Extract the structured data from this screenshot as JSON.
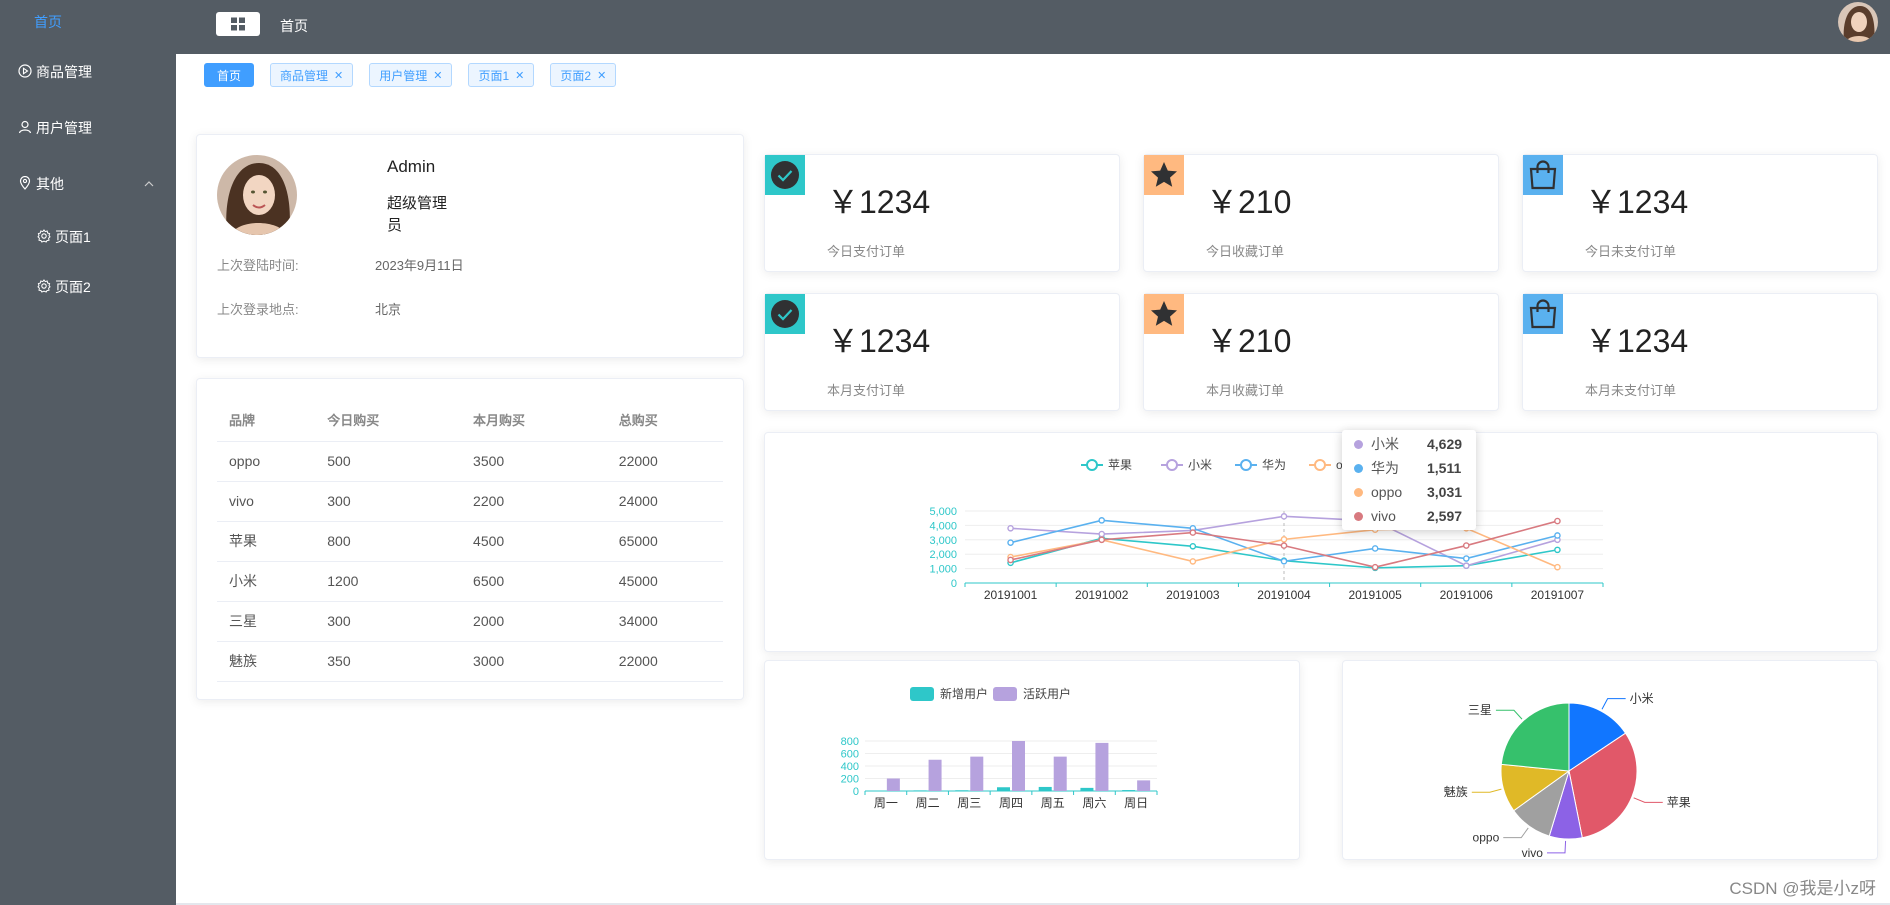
{
  "sidebar": {
    "top_label": "首页",
    "items": [
      {
        "label": "商品管理",
        "icon": "play-circle-icon"
      },
      {
        "label": "用户管理",
        "icon": "user-icon"
      },
      {
        "label": "其他",
        "icon": "location-icon"
      }
    ],
    "subitems": [
      {
        "label": "页面1",
        "icon": "gear-icon"
      },
      {
        "label": "页面2",
        "icon": "gear-icon"
      }
    ]
  },
  "header": {
    "breadcrumb": "首页"
  },
  "tabs": [
    {
      "label": "首页",
      "active": true
    },
    {
      "label": "商品管理"
    },
    {
      "label": "用户管理"
    },
    {
      "label": "页面1"
    },
    {
      "label": "页面2"
    }
  ],
  "user": {
    "name": "Admin",
    "role": "超级管理员",
    "last_login_time_label": "上次登陆时间:",
    "last_login_time": "2023年9月11日",
    "last_login_place_label": "上次登录地点:",
    "last_login_place": "北京"
  },
  "table": {
    "headers": [
      "品牌",
      "今日购买",
      "本月购买",
      "总购买"
    ],
    "rows": [
      [
        "oppo",
        "500",
        "3500",
        "22000"
      ],
      [
        "vivo",
        "300",
        "2200",
        "24000"
      ],
      [
        "苹果",
        "800",
        "4500",
        "65000"
      ],
      [
        "小米",
        "1200",
        "6500",
        "45000"
      ],
      [
        "三星",
        "300",
        "2000",
        "34000"
      ],
      [
        "魅族",
        "350",
        "3000",
        "22000"
      ]
    ]
  },
  "stats": [
    {
      "value": "￥1234",
      "label": "今日支付订单",
      "icon": "check-circle-icon",
      "color": "#2ec7c9"
    },
    {
      "value": "￥210",
      "label": "今日收藏订单",
      "icon": "star-icon",
      "color": "#ffb980"
    },
    {
      "value": "￥1234",
      "label": "今日未支付订单",
      "icon": "shopping-bag-icon",
      "color": "#5ab1ef"
    },
    {
      "value": "￥1234",
      "label": "本月支付订单",
      "icon": "check-circle-icon",
      "color": "#2ec7c9"
    },
    {
      "value": "￥210",
      "label": "本月收藏订单",
      "icon": "star-icon",
      "color": "#ffb980"
    },
    {
      "value": "￥1234",
      "label": "本月未支付订单",
      "icon": "shopping-bag-icon",
      "color": "#5ab1ef"
    }
  ],
  "tooltip": [
    {
      "name": "小米",
      "value": "4,629",
      "color": "#b6a2de"
    },
    {
      "name": "华为",
      "value": "1,511",
      "color": "#5ab1ef"
    },
    {
      "name": "oppo",
      "value": "3,031",
      "color": "#ffb980"
    },
    {
      "name": "vivo",
      "value": "2,597",
      "color": "#d87a80"
    }
  ],
  "watermark": "CSDN @我是小z呀",
  "chart_data": [
    {
      "type": "line",
      "x": [
        "20191001",
        "20191002",
        "20191003",
        "20191004",
        "20191005",
        "20191006",
        "20191007"
      ],
      "ylim": [
        0,
        5000
      ],
      "yticks": [
        "0",
        "1,000",
        "2,000",
        "3,000",
        "4,000",
        "5,000"
      ],
      "series": [
        {
          "name": "苹果",
          "color": "#2ec7c9",
          "values": [
            1400,
            3100,
            2550,
            1550,
            1050,
            1200,
            2300
          ]
        },
        {
          "name": "小米",
          "color": "#b6a2de",
          "values": [
            3800,
            3400,
            3650,
            4629,
            4300,
            1200,
            3000
          ]
        },
        {
          "name": "华为",
          "color": "#5ab1ef",
          "values": [
            2800,
            4350,
            3800,
            1511,
            2400,
            1700,
            3300
          ]
        },
        {
          "name": "oppo",
          "color": "#ffb980",
          "values": [
            1800,
            3000,
            1500,
            3031,
            3700,
            3800,
            1100
          ]
        },
        {
          "name": "vivo",
          "color": "#d87a80",
          "values": [
            1600,
            3000,
            3500,
            2597,
            1100,
            2600,
            4300
          ]
        }
      ]
    },
    {
      "type": "bar",
      "categories": [
        "周一",
        "周二",
        "周三",
        "周四",
        "周五",
        "周六",
        "周日"
      ],
      "ylim": [
        0,
        800
      ],
      "yticks": [
        "0",
        "200",
        "400",
        "600",
        "800"
      ],
      "series": [
        {
          "name": "新增用户",
          "color": "#2ec7c9",
          "values": [
            5,
            10,
            12,
            60,
            65,
            50,
            15
          ]
        },
        {
          "name": "活跃用户",
          "color": "#b6a2de",
          "values": [
            200,
            500,
            550,
            800,
            550,
            770,
            170
          ]
        }
      ]
    },
    {
      "type": "pie",
      "slices": [
        {
          "name": "小米",
          "value": 2999,
          "color": "#1176ff"
        },
        {
          "name": "苹果",
          "value": 5999,
          "color": "#e15869"
        },
        {
          "name": "vivo",
          "value": 1500,
          "color": "#8c62e6"
        },
        {
          "name": "oppo",
          "value": 1999,
          "color": "#a0a0a0"
        },
        {
          "name": "魅族",
          "value": 2200,
          "color": "#e0b927"
        },
        {
          "name": "三星",
          "value": 4500,
          "color": "#36c16c"
        }
      ]
    }
  ]
}
